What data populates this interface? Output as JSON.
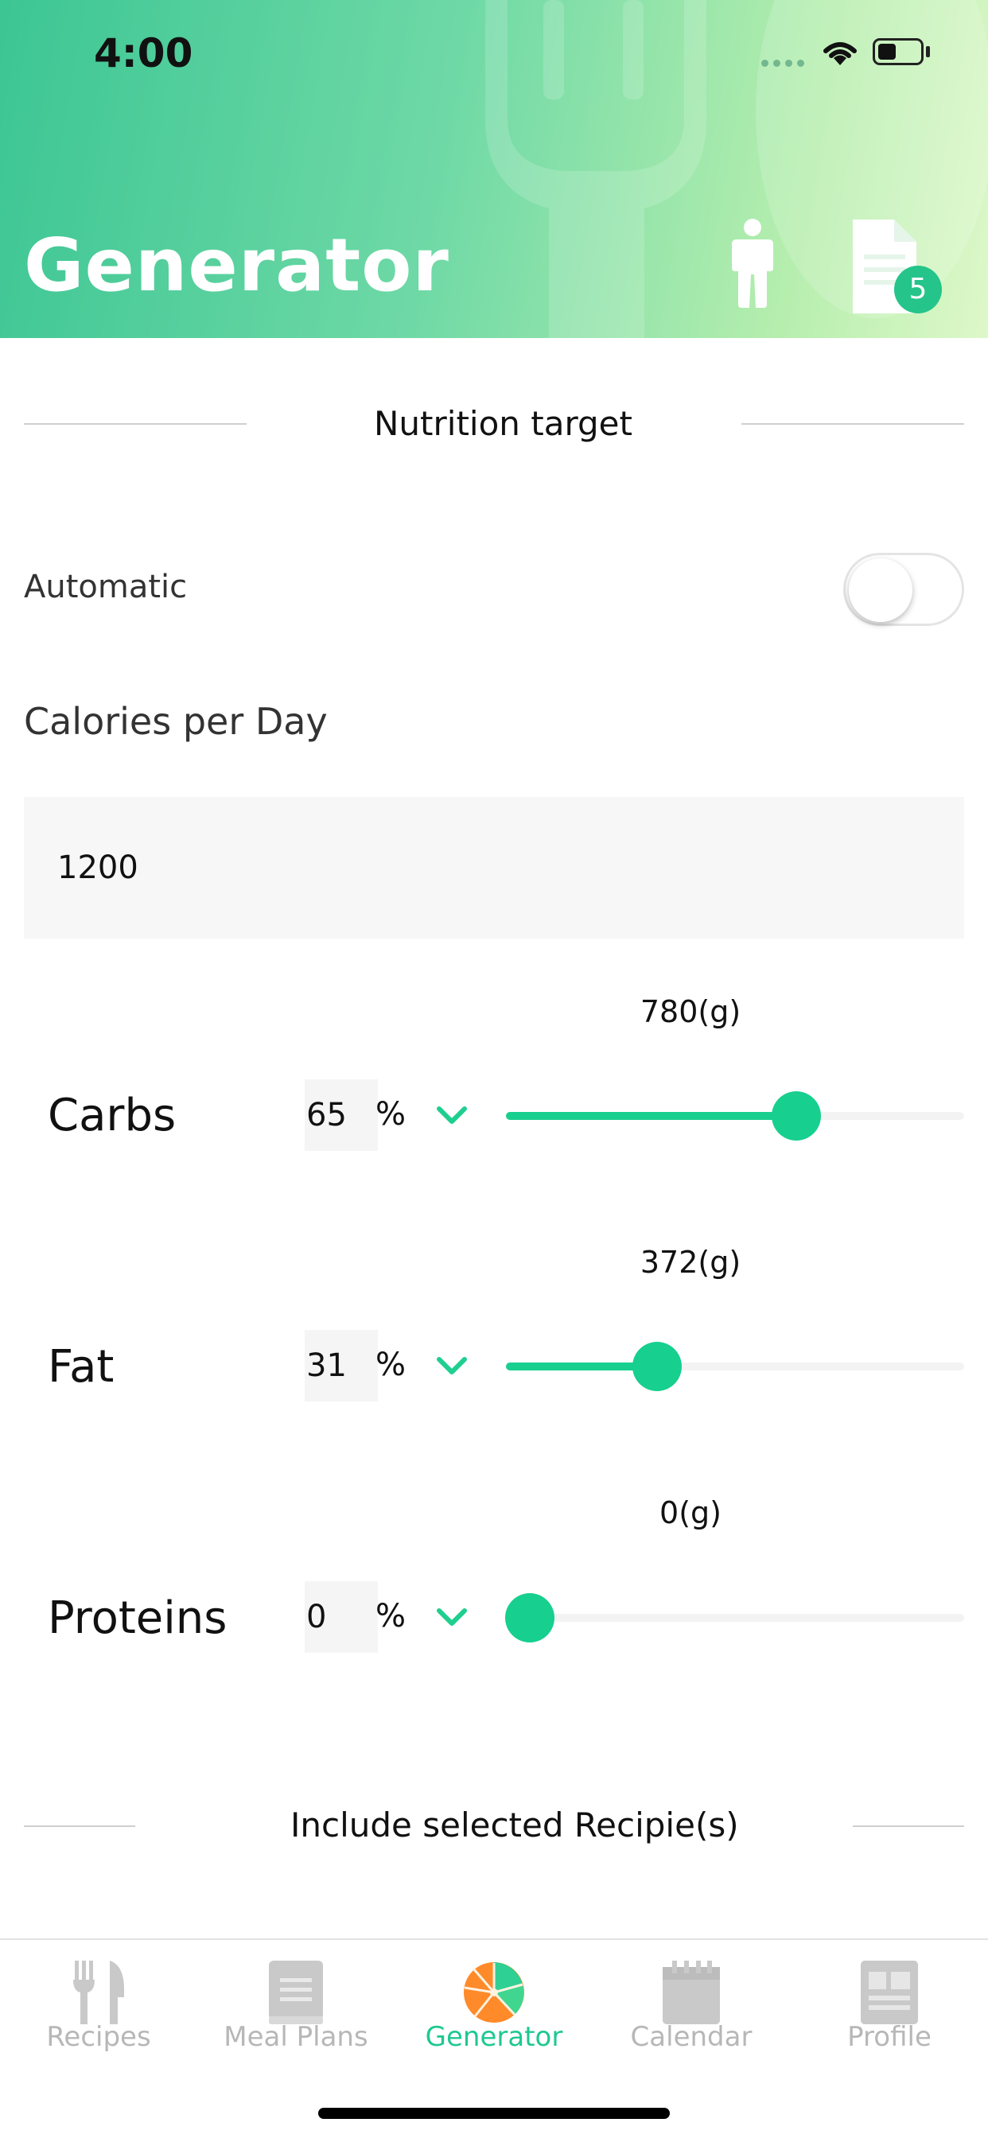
{
  "status": {
    "time": "4:00"
  },
  "header": {
    "title": "Generator",
    "document_badge": "5"
  },
  "nutrition": {
    "section_title": "Nutrition target",
    "automatic_label": "Automatic",
    "automatic_on": false,
    "calories_label": "Calories per Day",
    "calories_value": "1200"
  },
  "macros": [
    {
      "name": "Carbs",
      "percent": "65",
      "percent_sign": "%",
      "grams": "780(g)",
      "slider_fraction": 0.63
    },
    {
      "name": "Fat",
      "percent": "31",
      "percent_sign": "%",
      "grams": "372(g)",
      "slider_fraction": 0.3
    },
    {
      "name": "Proteins",
      "percent": "0",
      "percent_sign": "%",
      "grams": "0(g)",
      "slider_fraction": 0.0
    }
  ],
  "include_section": {
    "title": "Include selected Recipie(s)"
  },
  "tabs": [
    {
      "label": "Recipes",
      "icon": "fork-knife-icon",
      "active": false
    },
    {
      "label": "Meal Plans",
      "icon": "book-icon",
      "active": false
    },
    {
      "label": "Generator",
      "icon": "orange-slice-icon",
      "active": true
    },
    {
      "label": "Calendar",
      "icon": "calendar-icon",
      "active": false
    },
    {
      "label": "Profile",
      "icon": "profile-card-icon",
      "active": false
    }
  ],
  "colors": {
    "accent": "#1fcf8f",
    "header_start": "#3cc694",
    "header_end": "#def8c9",
    "tab_inactive": "#b7b7b7"
  }
}
